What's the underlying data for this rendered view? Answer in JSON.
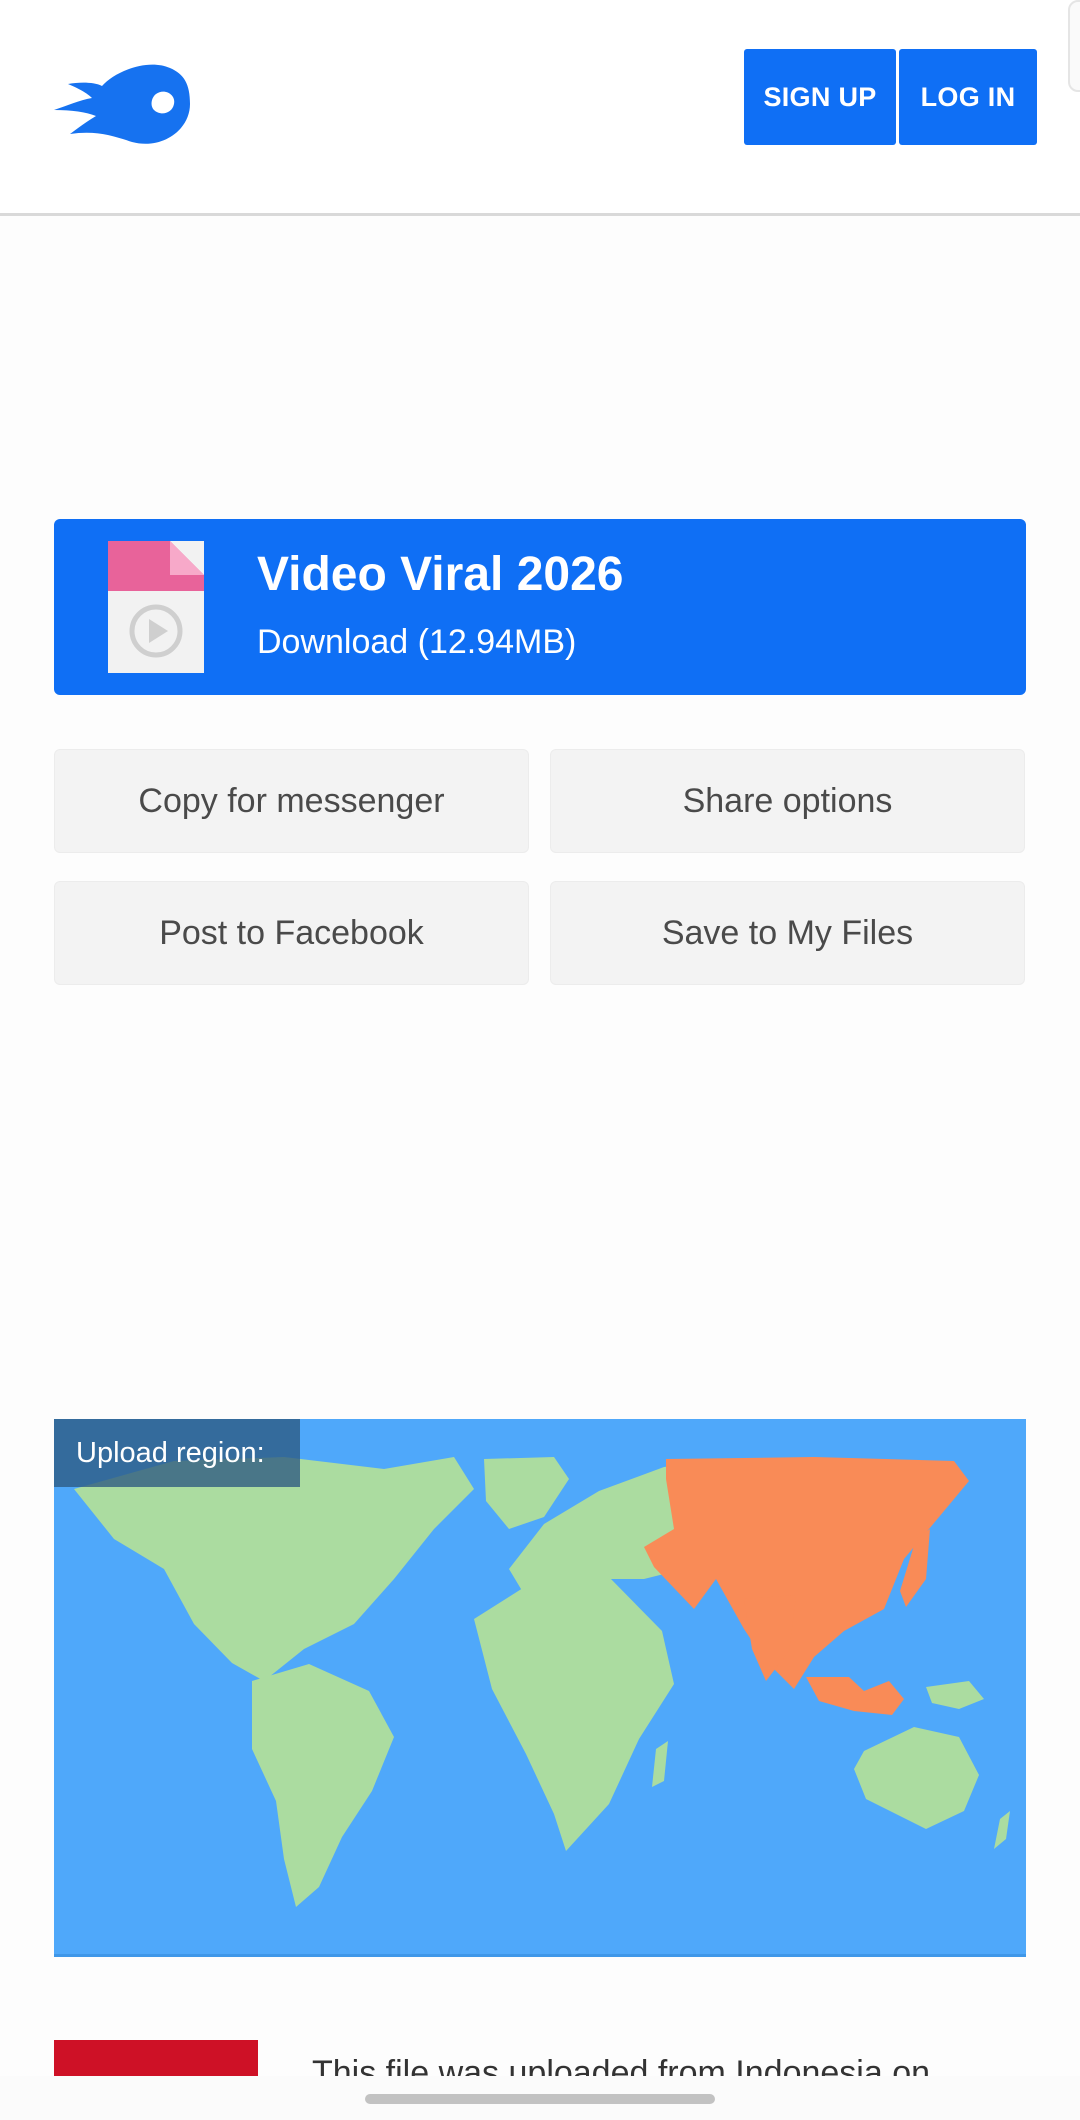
{
  "header": {
    "logo_icon": "flame-logo-icon",
    "sign_up_label": "SIGN UP",
    "log_in_label": "LOG IN"
  },
  "file": {
    "icon": "video-file-icon",
    "title": "Video Viral 2026",
    "download_label": "Download (12.94MB)"
  },
  "actions": {
    "copy_for_messenger": "Copy for messenger",
    "share_options": "Share options",
    "post_to_facebook": "Post to Facebook",
    "save_to_my_files": "Save to My Files"
  },
  "map": {
    "label": "Upload region:",
    "highlight_color": "#f98b57",
    "land_color": "#abdca0",
    "ocean_color": "#4fa8fa"
  },
  "upload_info": {
    "flag_icon": "indonesia-flag-icon",
    "text": "This file was uploaded from Indonesia on"
  },
  "colors": {
    "accent": "#0f6ff5"
  }
}
